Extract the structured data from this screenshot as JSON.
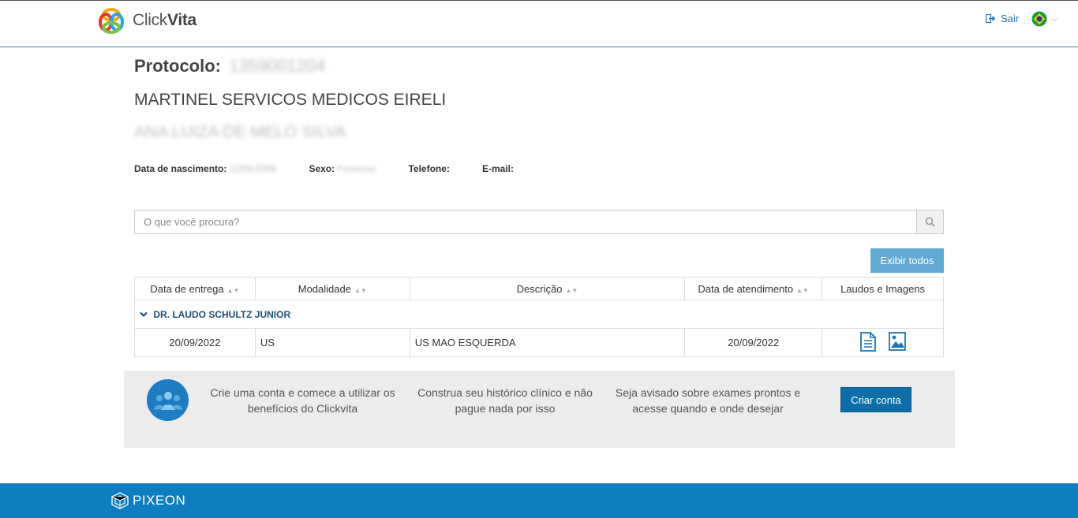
{
  "header": {
    "logo_light": "Click",
    "logo_bold": "Vita",
    "logout_label": "Sair",
    "language_flag": "brazil-flag",
    "colors": {
      "accent": "#1c74b5",
      "border": "#3d8b8f"
    }
  },
  "patient_info": {
    "protocol_label": "Protocolo:",
    "protocol_value": "1359001204",
    "company": "MARTINEL SERVICOS MEDICOS EIRELI",
    "patient_name": "ANA LUIZA DE MELO SILVA",
    "birth_label": "Data de nascimento:",
    "birth_value": "12/05/2008",
    "sex_label": "Sexo:",
    "sex_value": "Feminino",
    "phone_label": "Telefone:",
    "email_label": "E-mail:"
  },
  "search": {
    "placeholder": "O que você procura?",
    "value": ""
  },
  "show_all_label": "Exibir todos",
  "table": {
    "headers": [
      "Data de entrega",
      "Modalidade",
      "Descrição",
      "Data de atendimento",
      "Laudos e Imagens"
    ],
    "group_title": "DR. LAUDO SCHULTZ JUNIOR",
    "rows": [
      {
        "delivery": "20/09/2022",
        "modality": "US",
        "description": "US MAO ESQUERDA",
        "attendance": "20/09/2022"
      }
    ]
  },
  "banner": {
    "text1": "Crie uma conta e comece a utilizar os benefícios do Clickvita",
    "text2": "Construa seu histórico clínico e não pague nada por isso",
    "text3": "Seja avisado sobre exames prontos e acesse quando e onde desejar",
    "button_label": "Criar conta",
    "colors": {
      "background": "#ececec",
      "button": "#0d6ea8"
    }
  },
  "footer": {
    "brand": "PIXEON",
    "color": "#0e7ec0"
  }
}
